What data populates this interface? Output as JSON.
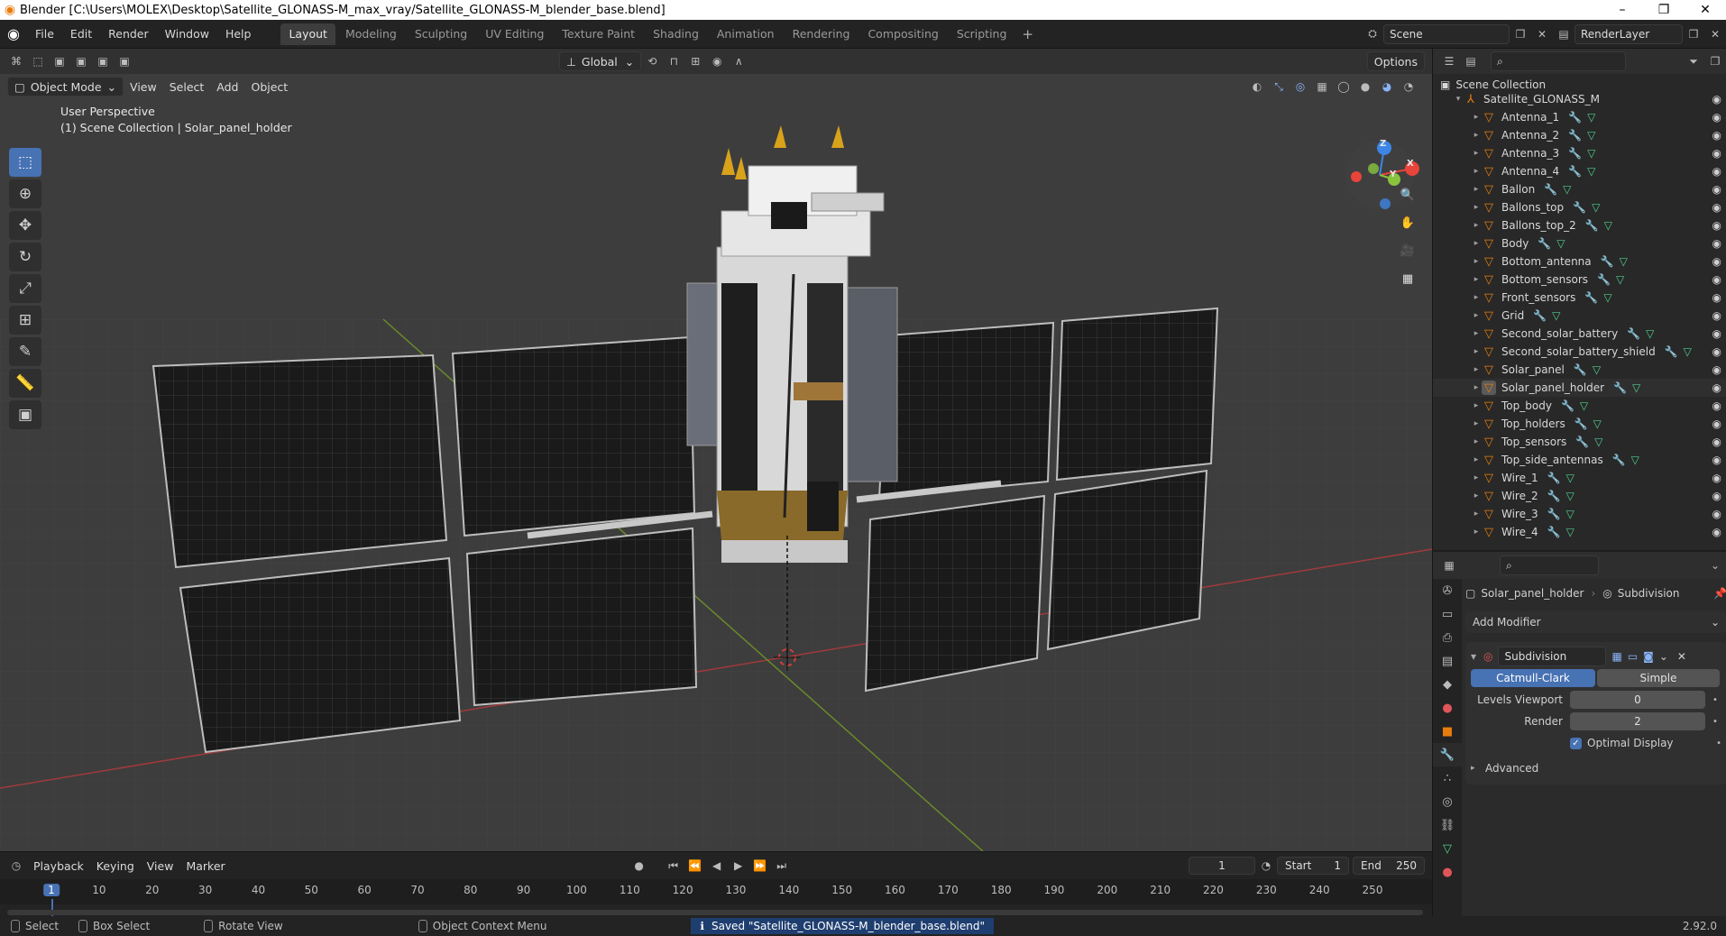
{
  "window": {
    "title": "Blender [C:\\Users\\MOLEX\\Desktop\\Satellite_GLONASS-M_max_vray/Satellite_GLONASS-M_blender_base.blend]",
    "minimize": "–",
    "maximize": "❐",
    "close": "✕"
  },
  "menu": {
    "items": [
      "File",
      "Edit",
      "Render",
      "Window",
      "Help"
    ]
  },
  "workspaces": {
    "tabs": [
      "Layout",
      "Modeling",
      "Sculpting",
      "UV Editing",
      "Texture Paint",
      "Shading",
      "Animation",
      "Rendering",
      "Compositing",
      "Scripting"
    ],
    "active": "Layout",
    "add": "+"
  },
  "scene": {
    "name": "Scene",
    "render_layer": "RenderLayer"
  },
  "viewport": {
    "orientation": "Global",
    "options": "Options",
    "mode": "Object Mode",
    "header_menu": [
      "View",
      "Select",
      "Add",
      "Object"
    ],
    "perspective": "User Perspective",
    "collection_info": "(1) Scene Collection | Solar_panel_holder",
    "gizmo": {
      "x": "X",
      "y": "Y",
      "z": "Z"
    }
  },
  "timeline": {
    "menu": [
      "Playback",
      "Keying",
      "View",
      "Marker"
    ],
    "current_frame": "1",
    "start_label": "Start",
    "start": "1",
    "end_label": "End",
    "end": "250",
    "ruler": [
      "1",
      "10",
      "20",
      "30",
      "40",
      "50",
      "60",
      "70",
      "80",
      "90",
      "100",
      "110",
      "120",
      "130",
      "140",
      "150",
      "160",
      "170",
      "180",
      "190",
      "200",
      "210",
      "220",
      "230",
      "240",
      "250"
    ]
  },
  "statusbar": {
    "select": "Select",
    "box_select": "Box Select",
    "rotate": "Rotate View",
    "context": "Object Context Menu",
    "message": "Saved \"Satellite_GLONASS-M_blender_base.blend\"",
    "version": "2.92.0"
  },
  "outliner": {
    "root": "Scene Collection",
    "collection": "Satellite_GLONASS_M",
    "objects": [
      "Antenna_1",
      "Antenna_2",
      "Antenna_3",
      "Antenna_4",
      "Ballon",
      "Ballons_top",
      "Ballons_top_2",
      "Body",
      "Bottom_antenna",
      "Bottom_sensors",
      "Front_sensors",
      "Grid",
      "Second_solar_battery",
      "Second_solar_battery_shield",
      "Solar_panel",
      "Solar_panel_holder",
      "Top_body",
      "Top_holders",
      "Top_sensors",
      "Top_side_antennas",
      "Wire_1",
      "Wire_2",
      "Wire_3",
      "Wire_4"
    ],
    "selected": "Solar_panel_holder"
  },
  "properties": {
    "object": "Solar_panel_holder",
    "modifier_crumb": "Subdivision",
    "add_modifier": "Add Modifier",
    "modifier_name": "Subdivision",
    "mode_a": "Catmull-Clark",
    "mode_b": "Simple",
    "levels_label": "Levels Viewport",
    "levels_value": "0",
    "render_label": "Render",
    "render_value": "2",
    "optimal_display": "Optimal Display",
    "advanced": "Advanced"
  },
  "colors": {
    "accent": "#4772b3",
    "object_orange": "#e87d0d",
    "mesh_green": "#4fd08f",
    "axis_x": "#e8443a",
    "axis_y": "#8ac43f",
    "axis_z": "#3d86e6"
  }
}
